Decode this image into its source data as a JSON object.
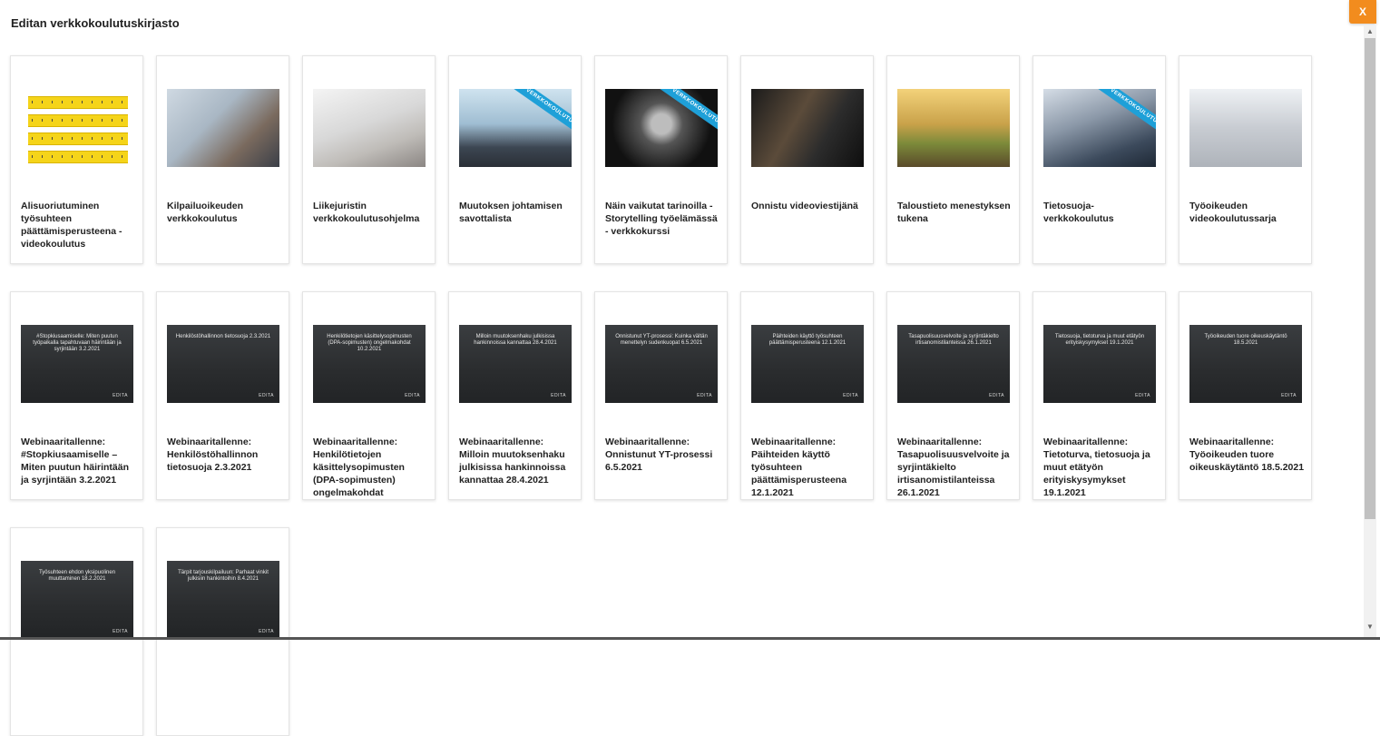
{
  "modal": {
    "title": "Editan verkkokoulutuskirjasto",
    "close_label": "X"
  },
  "badge": "VERKKOKOULUTUS",
  "courses": [
    {
      "title": "Alisuoriutuminen työsuhteen päättämisperusteena - videokoulutus",
      "thumb": "tape"
    },
    {
      "title": "Kilpailuoikeuden verkkokoulutus",
      "thumb": "office"
    },
    {
      "title": "Liikejuristin verkkokoulutusohjelma",
      "thumb": "laptop"
    },
    {
      "title": "Muutoksen johtamisen savottalista",
      "thumb": "woman"
    },
    {
      "title": "Näin vaikutat tarinoilla - Storytelling työelämässä - verkkokurssi",
      "thumb": "speaker"
    },
    {
      "title": "Onnistu videoviestijänä",
      "thumb": "video"
    },
    {
      "title": "Taloustieto menestyksen tukena",
      "thumb": "plants"
    },
    {
      "title": "Tietosuoja-verkkokoulutus",
      "thumb": "tech"
    },
    {
      "title": "Työoikeuden videokoulutussarja",
      "thumb": "aerial"
    },
    {
      "title": "Webinaaritallenne: #Stopkiusaamiselle – Miten puutun häirintään ja syrjintään 3.2.2021",
      "thumb": "webinar"
    },
    {
      "title": "Webinaaritallenne: Henkilöstöhallinnon tietosuoja 2.3.2021",
      "thumb": "webinar"
    },
    {
      "title": "Webinaaritallenne: Henkilötietojen käsittelysopimusten (DPA-sopimusten) ongelmakohdat",
      "thumb": "webinar"
    },
    {
      "title": "Webinaaritallenne: Milloin muutoksenhaku julkisissa hankinnoissa kannattaa 28.4.2021",
      "thumb": "webinar"
    },
    {
      "title": "Webinaaritallenne: Onnistunut YT-prosessi 6.5.2021",
      "thumb": "webinar"
    },
    {
      "title": "Webinaaritallenne: Päihteiden käyttö työsuhteen päättämisperusteena 12.1.2021",
      "thumb": "webinar"
    },
    {
      "title": "Webinaaritallenne: Tasapuolisuusvelvoite ja syrjintäkielto irtisanomistilanteissa 26.1.2021",
      "thumb": "webinar"
    },
    {
      "title": "Webinaaritallenne: Tietoturva, tietosuoja ja muut etätyön erityiskysymykset 19.1.2021",
      "thumb": "webinar"
    },
    {
      "title": "Webinaaritallenne: Työoikeuden tuore oikeuskäytäntö 18.5.2021",
      "thumb": "webinar"
    },
    {
      "title": "",
      "thumb": "webinar"
    },
    {
      "title": "",
      "thumb": "webinar"
    }
  ],
  "webinar_thumb_texts": [
    "#Stopkiusaamiselle: Miten puutun työpaikalla tapahtuvaan häirintään ja syrjintään 3.2.2021",
    "Henkilöstöhallinnon tietosuoja 2.3.2021",
    "Henkilötietojen käsittelysopimusten (DPA-sopimusten) ongelmakohdat 10.2.2021",
    "Milloin muutoksenhaku julkisissa hankinnoissa kannattaa 28.4.2021",
    "Onnistunut YT-prosessi: Kuinka vältän menettelyn sudenkuopat 6.5.2021",
    "Päihteiden käyttö työsuhteen päättämisperusteena 12.1.2021",
    "Tasapuolisuusvelvoite ja syrjintäkielto irtisanomistilanteissa 26.1.2021",
    "Tietosuoja, tietoturva ja muut etätyön erityiskysymykset 19.1.2021",
    "Työoikeuden tuore oikeuskäytäntö 18.5.2021",
    "Työsuhteen ehdon yksipuolinen muuttaminen 18.2.2021",
    "Tärpit tarjouskilpailuun: Parhaat vinkit julkisiin hankintoihin 8.4.2021"
  ],
  "logo_text": "EDITA"
}
